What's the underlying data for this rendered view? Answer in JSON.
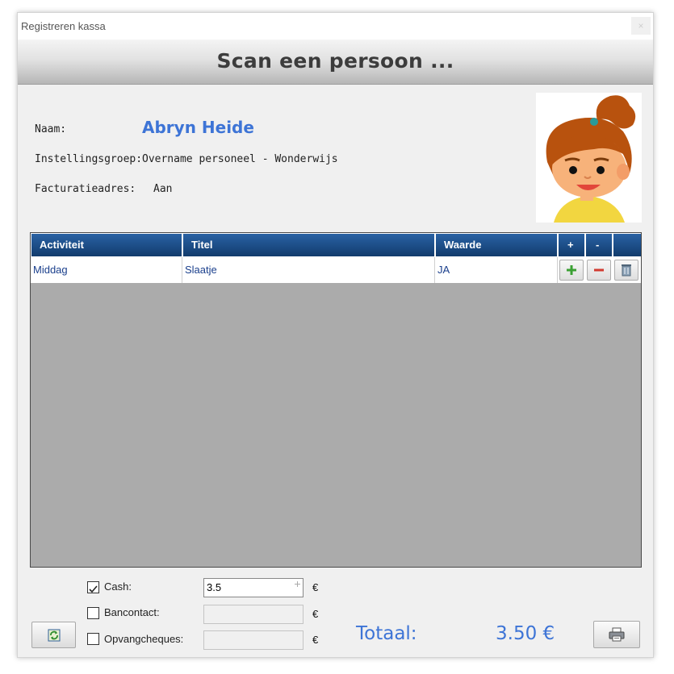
{
  "window": {
    "title": "Registreren kassa",
    "close_glyph": "×"
  },
  "header": {
    "banner_text": "Scan een persoon ..."
  },
  "person": {
    "name_label": "Naam:",
    "name_value": "Abryn Heide",
    "group_label": "Instellingsgroep:",
    "group_value": "Overname personeel - Wonderwijs",
    "billing_label": "Facturatieadres:",
    "billing_value": "Aan",
    "avatar_icon": "girl-avatar-icon"
  },
  "grid": {
    "columns": [
      "Activiteit",
      "Titel",
      "Waarde",
      "+",
      "-",
      ""
    ],
    "rows": [
      {
        "activiteit": "Middag",
        "titel": "Slaatje",
        "waarde": "JA"
      }
    ]
  },
  "payment": {
    "cash_label": "Cash:",
    "cash_checked": true,
    "cash_value": "3.5",
    "bancontact_label": "Bancontact:",
    "bancontact_checked": false,
    "bancontact_value": "",
    "opvang_label": "Opvangcheques:",
    "opvang_checked": false,
    "opvang_value": "",
    "currency": "€"
  },
  "total": {
    "label": "Totaal:",
    "value": "3.50 €"
  },
  "colors": {
    "accent_blue": "#3d74d6",
    "header_blue": "#1c4d86",
    "grid_gray": "#ababab"
  }
}
